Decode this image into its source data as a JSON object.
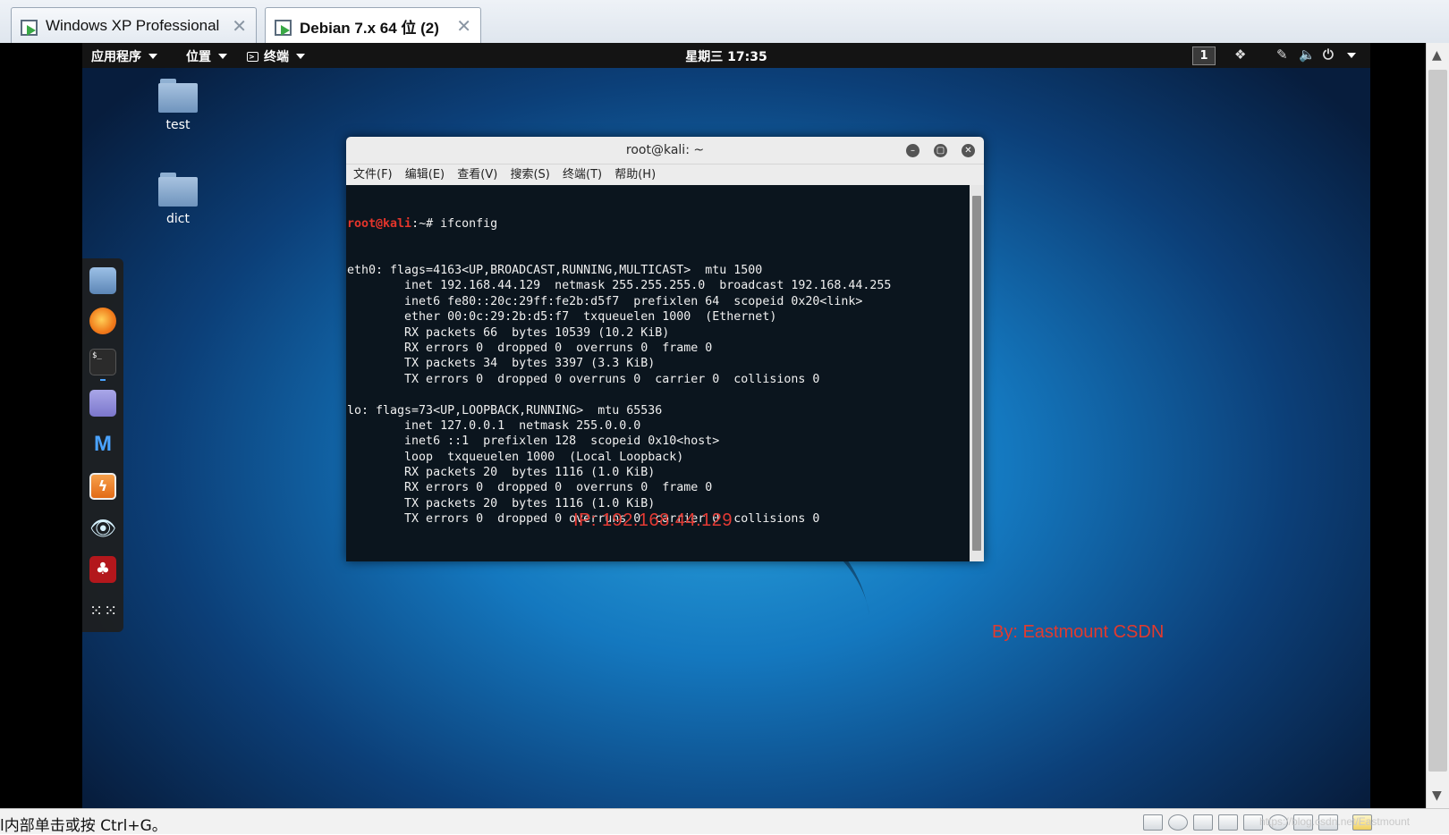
{
  "host": {
    "tabs": [
      {
        "label": "Windows XP Professional",
        "active": false
      },
      {
        "label": "Debian 7.x 64 位 (2)",
        "active": true
      }
    ],
    "status_hint": "l内部单击或按 Ctrl+G。",
    "status_watermark": "https://blog.csdn.net/Eastmount"
  },
  "panel": {
    "apps": "应用程序",
    "places": "位置",
    "terminal": "终端",
    "clock": "星期三 17:35",
    "workspace": "1"
  },
  "desktop": {
    "icons": [
      "test",
      "dict"
    ]
  },
  "dock": [
    "files",
    "firefox",
    "terminal",
    "text-editor",
    "metasploit",
    "burpsuite",
    "eye-tool",
    "cherrytree",
    "show-apps"
  ],
  "terminal": {
    "title": "root@kali: ~",
    "menu": [
      "文件(F)",
      "编辑(E)",
      "查看(V)",
      "搜索(S)",
      "终端(T)",
      "帮助(H)"
    ],
    "prompt_user": "root@kali",
    "prompt_suffix": ":~# ",
    "command": "ifconfig",
    "output": [
      "eth0: flags=4163<UP,BROADCAST,RUNNING,MULTICAST>  mtu 1500",
      "        inet 192.168.44.129  netmask 255.255.255.0  broadcast 192.168.44.255",
      "        inet6 fe80::20c:29ff:fe2b:d5f7  prefixlen 64  scopeid 0x20<link>",
      "        ether 00:0c:29:2b:d5:f7  txqueuelen 1000  (Ethernet)",
      "        RX packets 66  bytes 10539 (10.2 KiB)",
      "        RX errors 0  dropped 0  overruns 0  frame 0",
      "        TX packets 34  bytes 3397 (3.3 KiB)",
      "        TX errors 0  dropped 0 overruns 0  carrier 0  collisions 0",
      "",
      "lo: flags=73<UP,LOOPBACK,RUNNING>  mtu 65536",
      "        inet 127.0.0.1  netmask 255.0.0.0",
      "        inet6 ::1  prefixlen 128  scopeid 0x10<host>",
      "        loop  txqueuelen 1000  (Local Loopback)",
      "        RX packets 20  bytes 1116 (1.0 KiB)",
      "        RX errors 0  dropped 0  overruns 0  frame 0",
      "        TX packets 20  bytes 1116 (1.0 KiB)",
      "        TX errors 0  dropped 0 overruns 0  carrier 0  collisions 0",
      ""
    ],
    "ip_note": "IP:   192.168.44.129"
  },
  "byline": "By:  Eastmount CSDN",
  "colors": {
    "prompt": "#e5352b",
    "note": "#e43a34",
    "terminal_bg": "#0b151e"
  }
}
